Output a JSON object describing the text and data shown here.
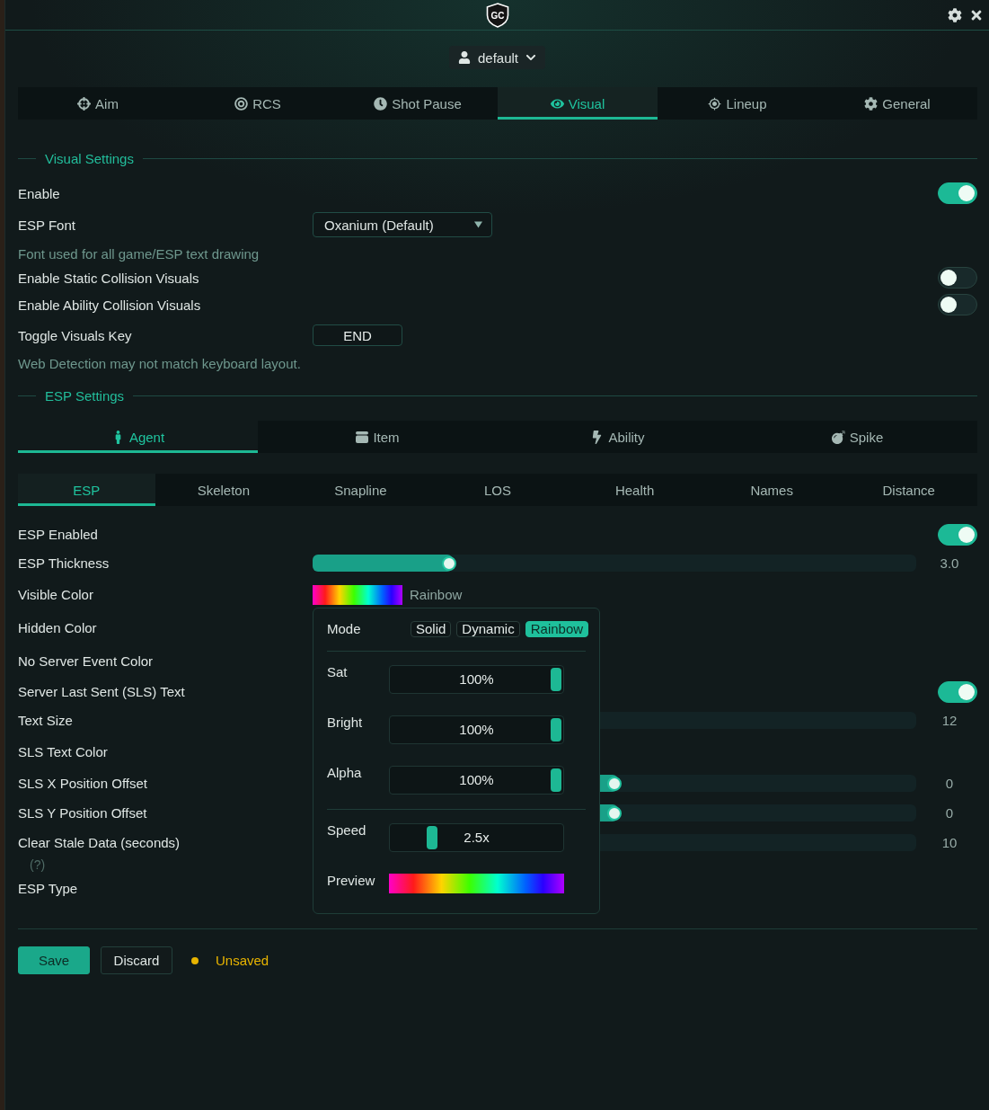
{
  "window": {
    "logo_text": "GC"
  },
  "profile": {
    "name": "default"
  },
  "tabs": [
    {
      "label": "Aim",
      "selected": false
    },
    {
      "label": "RCS",
      "selected": false
    },
    {
      "label": "Shot Pause",
      "selected": false
    },
    {
      "label": "Visual",
      "selected": true
    },
    {
      "label": "Lineup",
      "selected": false
    },
    {
      "label": "General",
      "selected": false
    }
  ],
  "visual_settings": {
    "title": "Visual Settings",
    "rows": [
      {
        "kind": "toggle",
        "label": "Enable",
        "on": true
      },
      {
        "kind": "select",
        "label": "ESP Font",
        "value": "Oxanium (Default)"
      },
      {
        "kind": "hint",
        "text": "Font used for all game/ESP text drawing"
      },
      {
        "kind": "toggle",
        "label": "Enable Static Collision Visuals",
        "on": false
      },
      {
        "kind": "toggle",
        "label": "Enable Ability Collision Visuals",
        "on": false
      },
      {
        "kind": "key",
        "label": "Toggle Visuals Key",
        "value": "END"
      },
      {
        "kind": "hint",
        "text": "Web Detection may not match keyboard layout."
      }
    ]
  },
  "esp_settings": {
    "title": "ESP Settings",
    "categories": [
      {
        "label": "Agent",
        "selected": true
      },
      {
        "label": "Item",
        "selected": false
      },
      {
        "label": "Ability",
        "selected": false
      },
      {
        "label": "Spike",
        "selected": false
      }
    ],
    "subtabs": [
      {
        "label": "ESP",
        "selected": true
      },
      {
        "label": "Skeleton",
        "selected": false
      },
      {
        "label": "Snapline",
        "selected": false
      },
      {
        "label": "LOS",
        "selected": false
      },
      {
        "label": "Health",
        "selected": false
      },
      {
        "label": "Names",
        "selected": false
      },
      {
        "label": "Distance",
        "selected": false
      }
    ],
    "rows": [
      {
        "kind": "toggle",
        "label": "ESP Enabled",
        "on": true
      },
      {
        "kind": "slider",
        "label": "ESP Thickness",
        "level": 0.22,
        "reading": "3.0"
      },
      {
        "kind": "color",
        "label": "Visible Color",
        "value": "Rainbow"
      },
      {
        "kind": "label",
        "label": "Hidden Color"
      },
      {
        "kind": "label",
        "label": "No Server Event Color"
      },
      {
        "kind": "toggle",
        "label": "Server Last Sent (SLS) Text",
        "on": true
      },
      {
        "kind": "slider",
        "label": "Text Size",
        "reading": "12"
      },
      {
        "kind": "label",
        "label": "SLS Text Color"
      },
      {
        "kind": "slider",
        "label": "SLS X Position Offset",
        "level": 0.5,
        "reading": "0"
      },
      {
        "kind": "slider",
        "label": "SLS Y Position Offset",
        "level": 0.5,
        "reading": "0"
      },
      {
        "kind": "slider",
        "label": "Clear Stale Data (seconds)",
        "help": "(?)",
        "reading": "10"
      },
      {
        "kind": "label",
        "label": "ESP Type"
      }
    ]
  },
  "color_popup": {
    "mode_label": "Mode",
    "modes": [
      {
        "label": "Solid",
        "selected": false
      },
      {
        "label": "Dynamic",
        "selected": false
      },
      {
        "label": "Rainbow",
        "selected": true
      }
    ],
    "sliders": [
      {
        "label": "Sat",
        "level": 1,
        "reading": "100%"
      },
      {
        "label": "Bright",
        "level": 1,
        "reading": "100%"
      },
      {
        "label": "Alpha",
        "level": 1,
        "reading": "100%"
      }
    ],
    "speed": {
      "label": "Speed",
      "level": 0.22,
      "reading": "2.5x"
    },
    "preview": {
      "label": "Preview"
    }
  },
  "footer": {
    "buttons": [
      {
        "kind": "primary",
        "label": "Save"
      },
      {
        "kind": "secondary",
        "label": "Discard"
      }
    ],
    "status": {
      "text": "Unsaved",
      "color": "#e8b400"
    }
  }
}
